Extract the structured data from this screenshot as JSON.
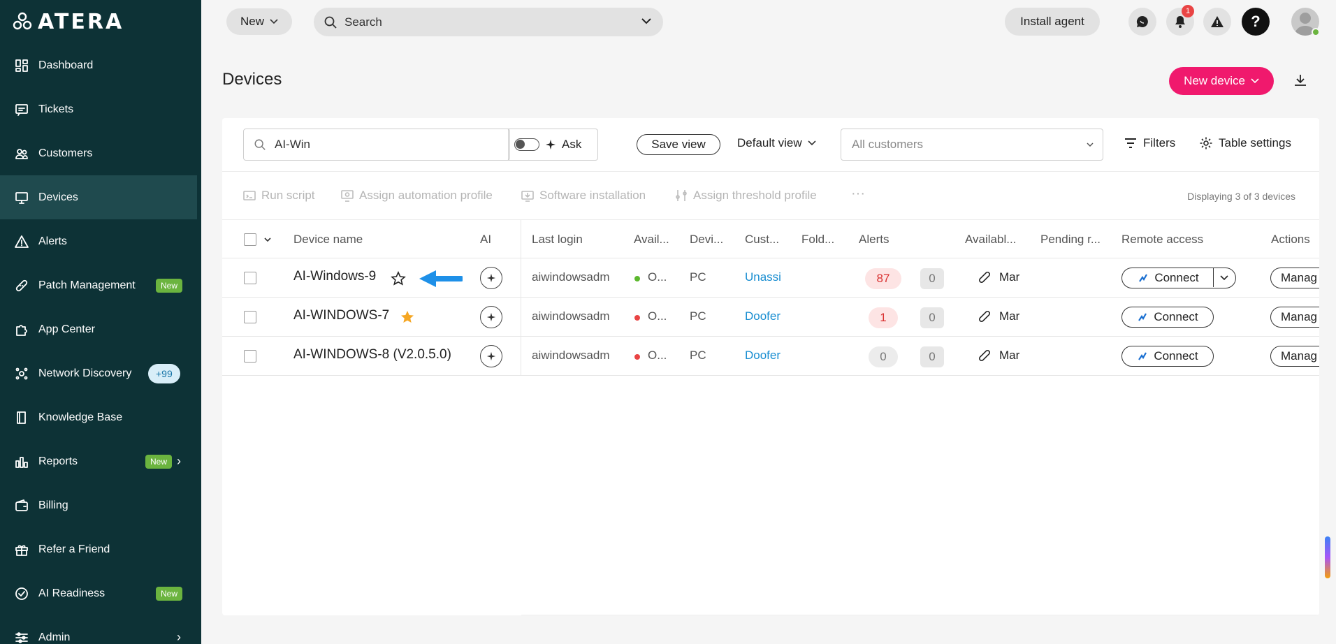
{
  "brand": {
    "logo_text": "ATERA"
  },
  "sidebar": {
    "items": [
      {
        "label": "Dashboard"
      },
      {
        "label": "Tickets"
      },
      {
        "label": "Customers"
      },
      {
        "label": "Devices"
      },
      {
        "label": "Alerts"
      },
      {
        "label": "Patch Management",
        "badge": "New"
      },
      {
        "label": "App Center"
      },
      {
        "label": "Network Discovery",
        "badge": "+99"
      },
      {
        "label": "Knowledge Base"
      },
      {
        "label": "Reports",
        "badge": "New"
      },
      {
        "label": "Billing"
      },
      {
        "label": "Refer a Friend"
      },
      {
        "label": "AI Readiness",
        "badge": "New"
      },
      {
        "label": "Admin"
      }
    ]
  },
  "topbar": {
    "new_label": "New",
    "search_placeholder": "Search",
    "install_agent_label": "Install agent",
    "notifications_count": "1"
  },
  "page": {
    "title": "Devices",
    "new_device_label": "New device"
  },
  "filters": {
    "search_value": "AI-Win",
    "ask_label": "Ask",
    "save_view_label": "Save view",
    "default_view_label": "Default view",
    "customers_placeholder": "All customers",
    "filters_label": "Filters",
    "table_settings_label": "Table settings"
  },
  "bulk_actions": {
    "run_script": "Run script",
    "assign_automation": "Assign automation profile",
    "software_installation": "Software installation",
    "assign_threshold": "Assign threshold profile",
    "more": "···",
    "displaying": "Displaying 3 of 3 devices"
  },
  "table": {
    "headers": {
      "device_name": "Device name",
      "ai": "AI",
      "last_login": "Last login",
      "availability": "Avail...",
      "device_type": "Devi...",
      "customer": "Cust...",
      "folder": "Fold...",
      "alerts": "Alerts",
      "available_patches": "Availabl...",
      "pending_reboot": "Pending r...",
      "remote_access": "Remote access",
      "actions": "Actions"
    },
    "rows": [
      {
        "name": "AI-Windows-9",
        "last_login": "aiwindowsadm",
        "status": "O...",
        "status_color": "#5cb82e",
        "type": "PC",
        "customer": "Unassi",
        "alerts": "87",
        "alerts_zero": "0",
        "patches": "Mar",
        "connect": "Connect",
        "manage": "Manag",
        "starred": false
      },
      {
        "name": "AI-WINDOWS-7",
        "last_login": "aiwindowsadm",
        "status": "O...",
        "status_color": "#e94444",
        "type": "PC",
        "customer": "Doofer",
        "alerts": "1",
        "alerts_zero": "0",
        "patches": "Mar",
        "connect": "Connect",
        "manage": "Manag",
        "starred": true
      },
      {
        "name": "AI-WINDOWS-8 (V2.0.5.0)",
        "last_login": "aiwindowsadm",
        "status": "O...",
        "status_color": "#e94444",
        "type": "PC",
        "customer": "Doofer",
        "alerts": "0",
        "alerts_zero": "0",
        "patches": "Mar",
        "connect": "Connect",
        "manage": "Manag",
        "starred": false
      }
    ]
  },
  "colors": {
    "sidebar_bg": "#0d3236",
    "accent": "#f0196d",
    "link": "#1a8ed1",
    "star": "#f5a623",
    "arrow": "#1e90e8"
  }
}
